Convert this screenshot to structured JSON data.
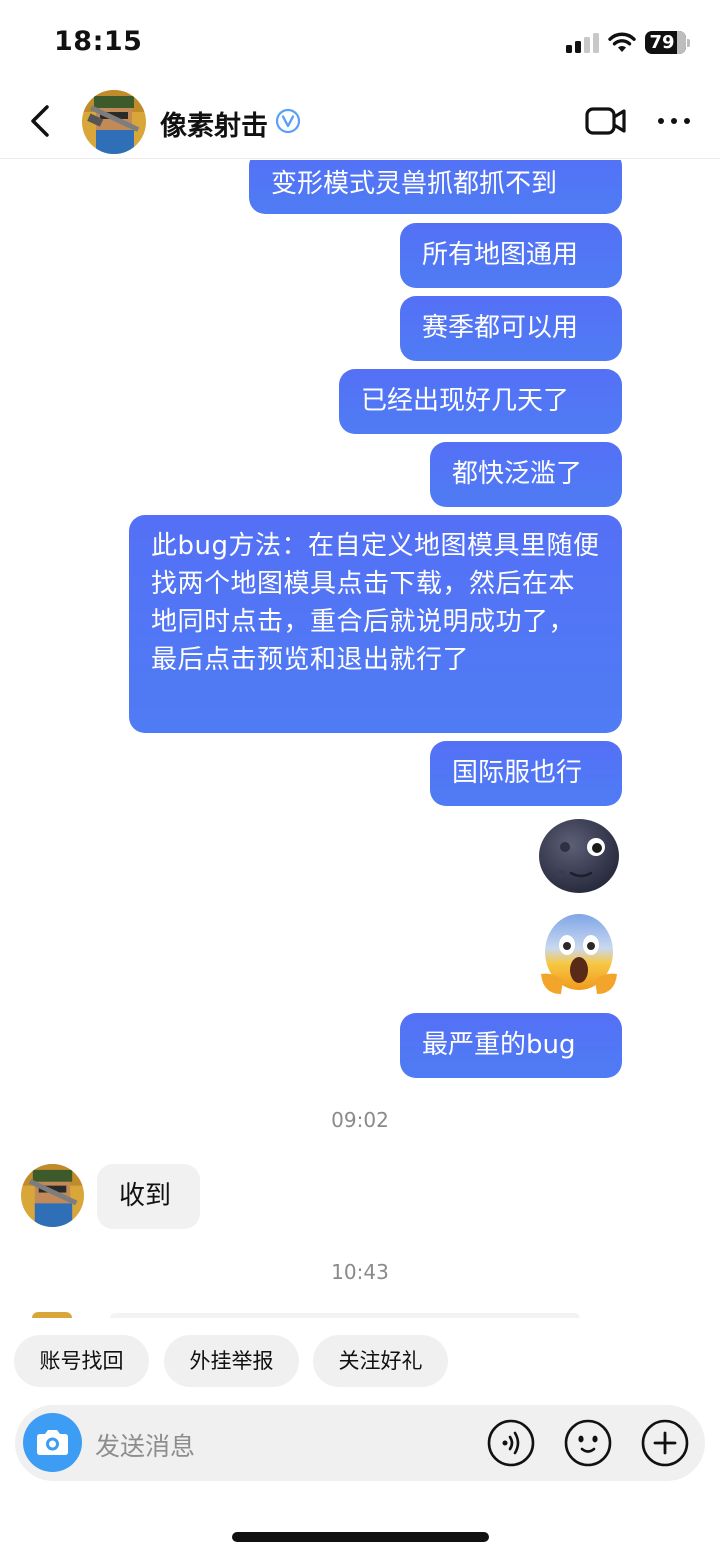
{
  "status_bar": {
    "time": "18:15",
    "battery": "79"
  },
  "header": {
    "contact_name": "像素射击",
    "icons": [
      "back-icon",
      "verified-icon",
      "video-call-icon",
      "more-icon"
    ]
  },
  "messages": {
    "sent": [
      "变形模式灵兽抓都抓不到",
      "所有地图通用",
      "赛季都可以用",
      "已经出现好几天了",
      "都快泛滥了",
      "此bug方法：在自定义地图模具里随便找两个地图模具点击下载，然后在本地同时点击，重合后就说明成功了，最后点击预览和退出就行了",
      "国际服也行",
      "最严重的bug"
    ],
    "emojis": [
      "new-moon-face",
      "face-screaming-in-fear"
    ],
    "timestamp_1": "09:02",
    "received_1": "收到",
    "timestamp_2": "10:43"
  },
  "quick_replies": [
    "账号找回",
    "外挂举报",
    "关注好礼"
  ],
  "input": {
    "placeholder": "发送消息",
    "icons": [
      "camera-icon",
      "voice-icon",
      "emoji-icon",
      "plus-icon"
    ]
  },
  "colors": {
    "sent_bubble": "#5274F5",
    "received_bubble": "#F1F1F1",
    "camera_button": "#3D9DF5",
    "verified": "#5aa0f5"
  }
}
